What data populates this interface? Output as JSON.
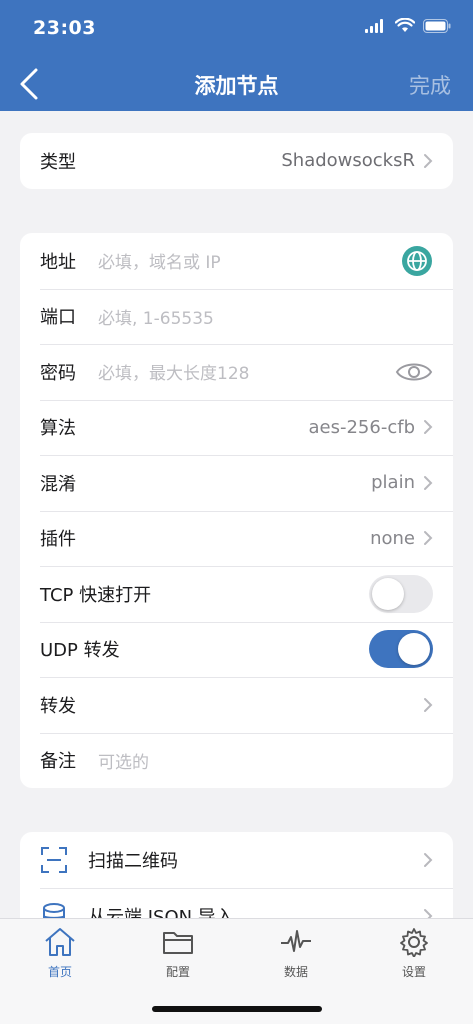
{
  "status_bar": {
    "time": "23:03"
  },
  "nav": {
    "title": "添加节点",
    "done_label": "完成"
  },
  "type_card": {
    "label": "类型",
    "value": "ShadowsocksR"
  },
  "form": {
    "address": {
      "label": "地址",
      "placeholder": "必填，域名或 IP"
    },
    "port": {
      "label": "端口",
      "placeholder": "必填, 1-65535"
    },
    "password": {
      "label": "密码",
      "placeholder": "必填，最大长度128"
    },
    "algorithm": {
      "label": "算法",
      "value": "aes-256-cfb"
    },
    "obfs": {
      "label": "混淆",
      "value": "plain"
    },
    "plugin": {
      "label": "插件",
      "value": "none"
    },
    "tcp_fast_open": {
      "label": "TCP 快速打开",
      "enabled": false
    },
    "udp_relay": {
      "label": "UDP 转发",
      "enabled": true
    },
    "forward": {
      "label": "转发"
    },
    "remark": {
      "label": "备注",
      "placeholder": "可选的"
    }
  },
  "actions": {
    "scan_qr": {
      "label": "扫描二维码",
      "icon": "scan-icon"
    },
    "import_json": {
      "label": "从云端 JSON 导入",
      "icon": "database-icon"
    }
  },
  "tabbar": {
    "items": [
      {
        "label": "首页",
        "icon": "home-icon",
        "active": true
      },
      {
        "label": "配置",
        "icon": "folder-icon",
        "active": false
      },
      {
        "label": "数据",
        "icon": "activity-icon",
        "active": false
      },
      {
        "label": "设置",
        "icon": "gear-icon",
        "active": false
      }
    ]
  },
  "colors": {
    "accent": "#3e74bf",
    "background": "#f2f2f4",
    "teal_icon": "#3aa6a0"
  }
}
